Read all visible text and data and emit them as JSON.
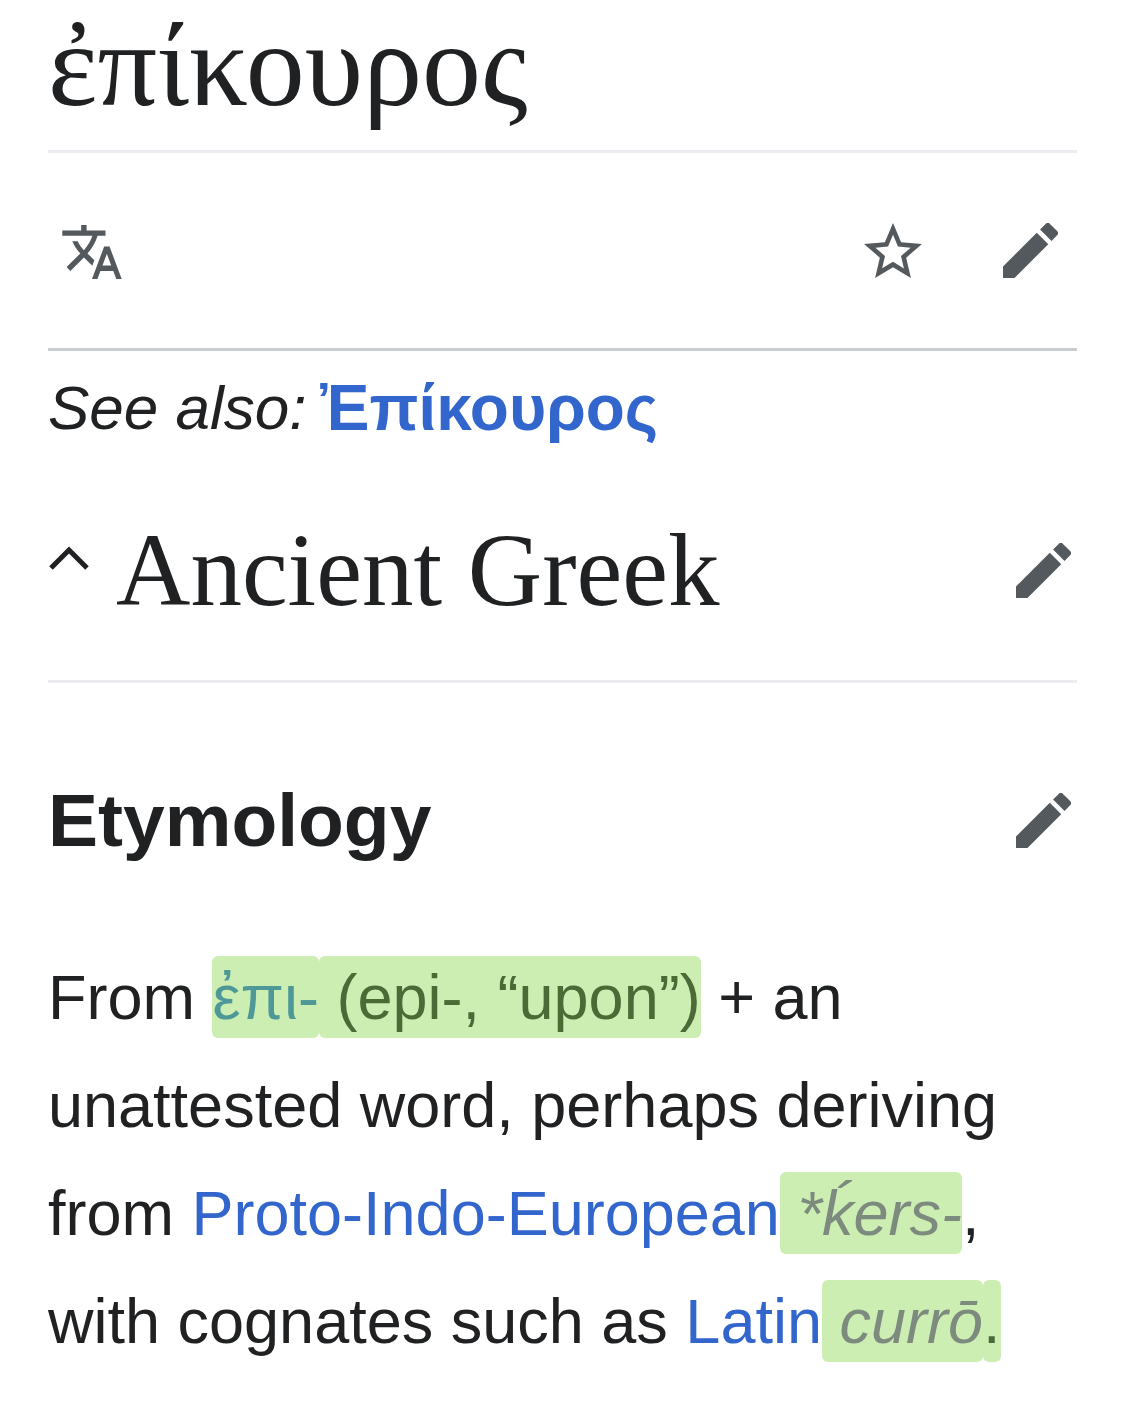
{
  "page_title": "ἐπίκουρος",
  "page_actions": {
    "watched": false
  },
  "see_also": {
    "label": "See also:",
    "link": "Ἐπίκουρος"
  },
  "sections": [
    {
      "kind": "language",
      "title": "Ancient Greek",
      "expanded": true
    },
    {
      "kind": "subsection",
      "title": "Etymology",
      "paragraph": [
        {
          "kind": "text",
          "text": "From ",
          "highlighted": false
        },
        {
          "kind": "link",
          "text": "ἐπι-",
          "highlighted": true
        },
        {
          "kind": "text",
          "text": " (epi-, “upon”)",
          "highlighted": true
        },
        {
          "kind": "text",
          "text": " + an unattested word, perhaps deriving from ",
          "highlighted": false
        },
        {
          "kind": "link",
          "text": "Proto-Indo-European",
          "highlighted": false
        },
        {
          "kind": "term",
          "text": " *ḱers-",
          "highlighted": true
        },
        {
          "kind": "text",
          "text": ", with cognates such as ",
          "highlighted": false
        },
        {
          "kind": "link",
          "text": "Latin",
          "highlighted": false
        },
        {
          "kind": "term",
          "text": " currō",
          "highlighted": true
        },
        {
          "kind": "text",
          "text": ".",
          "highlighted": true
        }
      ]
    }
  ]
}
